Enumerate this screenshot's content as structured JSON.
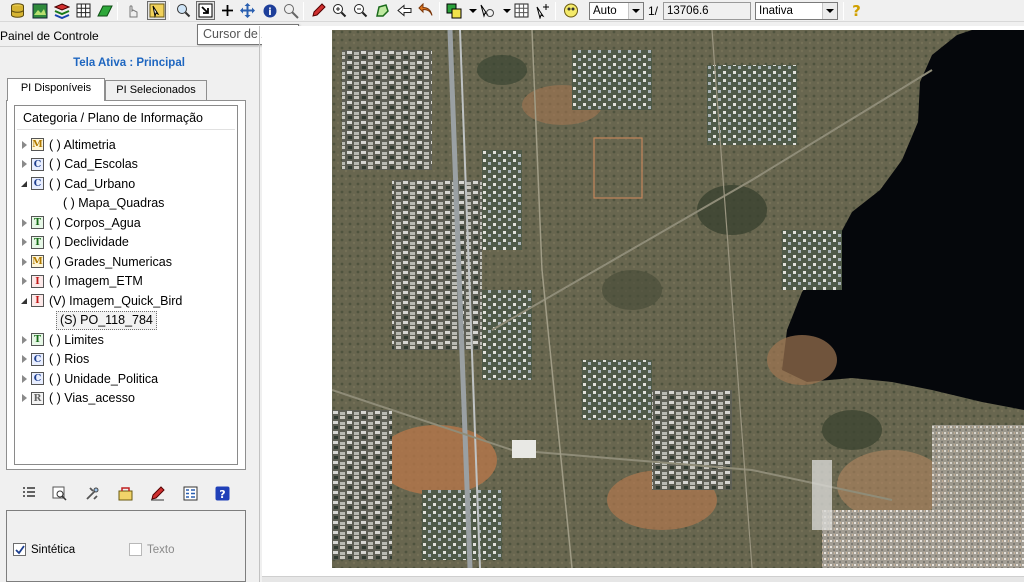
{
  "toolbar": {
    "zoom_mode_value": "Auto",
    "scale_prefix": "1/",
    "scale_value": "13706.6",
    "active_mode_value": "Inativa",
    "tooltip": "Cursor de Zoom"
  },
  "panel": {
    "title": "Painel de Controle",
    "active_screen": "Tela Ativa : Principal",
    "tabs": [
      {
        "label": "PI Disponíveis",
        "selected": true
      },
      {
        "label": "PI Selecionados",
        "selected": false
      }
    ],
    "tree_header": "Categoria / Plano de Informação",
    "tree": [
      {
        "cat": "M",
        "kind": "m",
        "label": "( ) Altimetria",
        "expanded": false
      },
      {
        "cat": "C",
        "kind": "c",
        "label": "( ) Cad_Escolas",
        "expanded": false
      },
      {
        "cat": "C",
        "kind": "c",
        "label": "( ) Cad_Urbano",
        "expanded": true,
        "children": [
          "( ) Mapa_Quadras"
        ]
      },
      {
        "cat": "T",
        "kind": "t",
        "label": "( ) Corpos_Agua",
        "expanded": false
      },
      {
        "cat": "T",
        "kind": "t",
        "label": "( ) Declividade",
        "expanded": false
      },
      {
        "cat": "M",
        "kind": "m",
        "label": "( ) Grades_Numericas",
        "expanded": false
      },
      {
        "cat": "I",
        "kind": "i",
        "label": "( ) Imagem_ETM",
        "expanded": false
      },
      {
        "cat": "I",
        "kind": "i",
        "label": "(V) Imagem_Quick_Bird",
        "expanded": true,
        "children": [
          "(S) PO_118_784"
        ]
      },
      {
        "cat": "T",
        "kind": "t",
        "label": "( ) Limites",
        "expanded": false
      },
      {
        "cat": "C",
        "kind": "c",
        "label": "( ) Rios",
        "expanded": false
      },
      {
        "cat": "C",
        "kind": "c",
        "label": "( ) Unidade_Politica",
        "expanded": false
      },
      {
        "cat": "R",
        "kind": "r",
        "label": "( ) Vias_acesso",
        "expanded": false
      }
    ],
    "checkboxes": [
      {
        "label": "Sintética",
        "checked": true,
        "enabled": true
      },
      {
        "label": "Texto",
        "checked": false,
        "enabled": false
      }
    ]
  },
  "colors": {
    "accent": "#1e66c0",
    "lake": "#05070b",
    "terrain": "#6b6a52",
    "soil": "#b5774a"
  }
}
